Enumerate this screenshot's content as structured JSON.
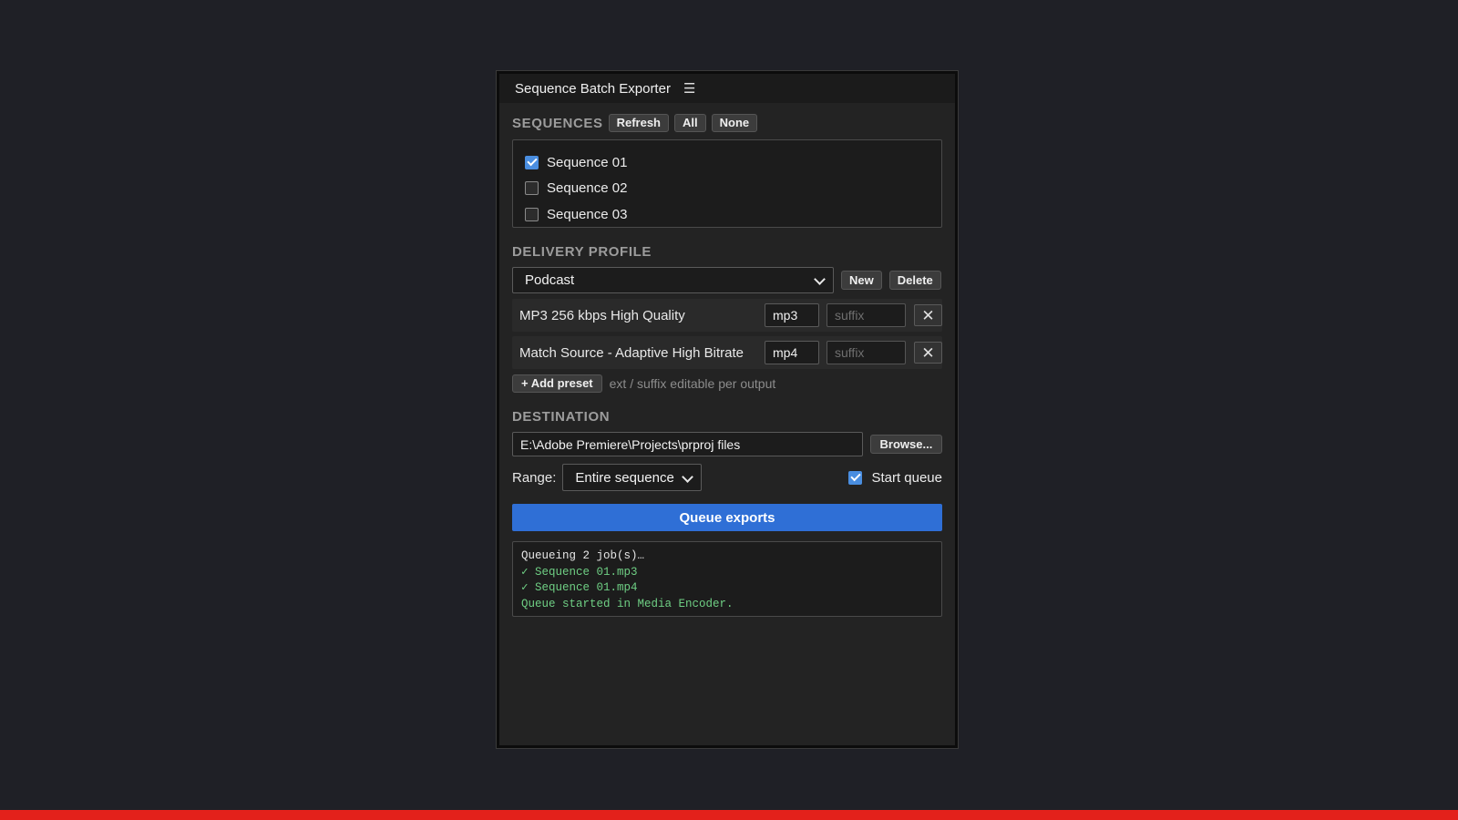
{
  "panel": {
    "title": "Sequence Batch Exporter",
    "menu_icon": "hamburger-menu-icon"
  },
  "sequences": {
    "label": "SEQUENCES",
    "refresh_label": "Refresh",
    "all_label": "All",
    "none_label": "None",
    "items": [
      {
        "label": "Sequence 01",
        "checked": true
      },
      {
        "label": "Sequence 02",
        "checked": false
      },
      {
        "label": "Sequence 03",
        "checked": false
      }
    ]
  },
  "delivery_profile": {
    "label": "DELIVERY PROFILE",
    "selected": "Podcast",
    "new_label": "New",
    "delete_label": "Delete",
    "presets": [
      {
        "name": "MP3 256 kbps High Quality",
        "ext": "mp3",
        "suffix": "",
        "suffix_placeholder": "suffix"
      },
      {
        "name": "Match Source - Adaptive High Bitrate",
        "ext": "mp4",
        "suffix": "",
        "suffix_placeholder": "suffix"
      }
    ],
    "add_preset_label": "+ Add preset",
    "hint": "ext / suffix editable per output"
  },
  "destination": {
    "label": "DESTINATION",
    "path": "E:\\Adobe Premiere\\Projects\\prproj files",
    "browse_label": "Browse...",
    "range_label": "Range:",
    "range_selected": "Entire sequence",
    "start_queue_label": "Start queue",
    "start_queue_checked": true
  },
  "queue_button_label": "Queue exports",
  "log": [
    {
      "text": "Queueing 2 job(s)…",
      "status": "plain"
    },
    {
      "text": "✓ Sequence 01.mp3",
      "status": "ok"
    },
    {
      "text": "✓ Sequence 01.mp4",
      "status": "ok"
    },
    {
      "text": "Queue started in Media Encoder.",
      "status": "ok"
    }
  ],
  "colors": {
    "accent": "#2f6fd6",
    "checkbox": "#4a8ee0",
    "success_text": "#6fcf84",
    "bottom_bar": "#e3211b"
  }
}
